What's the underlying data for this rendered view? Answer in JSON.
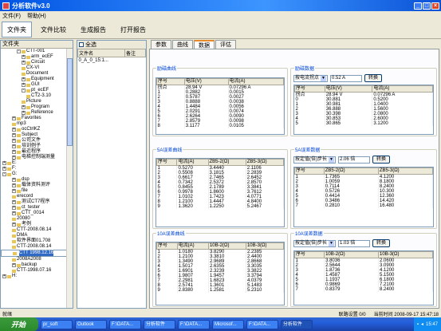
{
  "window": {
    "title": "分析软件v3.0"
  },
  "menu": [
    "文件(F)",
    "帮助(H)"
  ],
  "toolbar": [
    "文件夹",
    "文件比较",
    "生成报告",
    "打开报告"
  ],
  "filepane": {
    "header": "文件夹",
    "tree": [
      {
        "label": "CTT-001",
        "indent": 3,
        "box": "-"
      },
      {
        "label": "arm_ecEF",
        "indent": 4,
        "box": "+"
      },
      {
        "label": "Circuit",
        "indent": 4,
        "box": "+"
      },
      {
        "label": "CX-VI",
        "indent": 4,
        "box": ""
      },
      {
        "label": "Document",
        "indent": 4,
        "box": ""
      },
      {
        "label": "Equipment",
        "indent": 4,
        "box": "+"
      },
      {
        "label": "GUI",
        "indent": 4,
        "box": "+"
      },
      {
        "label": "pt_ecEF",
        "indent": 4,
        "box": "-"
      },
      {
        "label": "CT2-3.10",
        "indent": 5,
        "box": ""
      },
      {
        "label": "Picture",
        "indent": 4,
        "box": ""
      },
      {
        "label": "Program",
        "indent": 4,
        "box": "+"
      },
      {
        "label": "Reference",
        "indent": 4,
        "box": "+"
      },
      {
        "label": "Favorites",
        "indent": 2,
        "box": "+"
      },
      {
        "label": "mp3",
        "indent": 2,
        "box": ""
      },
      {
        "label": "ocCtrlKZ",
        "indent": 2,
        "box": "+"
      },
      {
        "label": "Subject",
        "indent": 2,
        "box": "+"
      },
      {
        "label": "公司文件",
        "indent": 2,
        "box": "+"
      },
      {
        "label": "培训例子",
        "indent": 2,
        "box": "+"
      },
      {
        "label": "最近程序",
        "indent": 2,
        "box": "+"
      },
      {
        "label": "电梯控制端测量",
        "indent": 2,
        "box": "+"
      },
      {
        "label": "E:",
        "indent": 0,
        "box": "+"
      },
      {
        "label": "F:",
        "indent": 0,
        "box": "+"
      },
      {
        "label": "G:",
        "indent": 0,
        "box": "-"
      },
      {
        "label": "dsp",
        "indent": 2,
        "box": "+"
      },
      {
        "label": "载体资料测评",
        "indent": 2,
        "box": "+"
      },
      {
        "label": "file",
        "indent": 2,
        "box": "+"
      },
      {
        "label": "erecord",
        "indent": 2,
        "box": ""
      },
      {
        "label": "测试CT7程序",
        "indent": 2,
        "box": "+"
      },
      {
        "label": "ct_tester",
        "indent": 2,
        "box": "+"
      },
      {
        "label": "CTT_0014",
        "indent": 2,
        "box": "+"
      },
      {
        "label": "20080",
        "indent": 2,
        "box": ""
      },
      {
        "label": "考例",
        "indent": 2,
        "box": "+"
      },
      {
        "label": "CTT-2008.08.14",
        "indent": 2,
        "box": ""
      },
      {
        "label": "DMA",
        "indent": 2,
        "box": ""
      },
      {
        "label": "软件界面01.708",
        "indent": 2,
        "box": ""
      },
      {
        "label": "CTT-2008.08.14",
        "indent": 2,
        "box": ""
      },
      {
        "label": "CTT 1998.12.16",
        "indent": 2,
        "box": "",
        "selected": true
      },
      {
        "label": "2008A2008",
        "indent": 2,
        "box": ""
      },
      {
        "label": "backup",
        "indent": 2,
        "box": "+"
      },
      {
        "label": "CTT-1998.07.16",
        "indent": 2,
        "box": ""
      },
      {
        "label": "H:",
        "indent": 0,
        "box": "+"
      }
    ]
  },
  "listpane": {
    "check_all": "全选",
    "columns": [
      "文件名",
      "备注"
    ],
    "rows": [
      [
        "0_A_0_15:1...",
        ""
      ]
    ]
  },
  "tabs": [
    "参数",
    "曲线",
    "数据",
    "评估"
  ],
  "active_tab": "数据",
  "groups": {
    "excitation": {
      "title": "励磁曲线",
      "columns": [
        "序号",
        "电压(V)",
        "电流(A)"
      ],
      "rows": [
        [
          "拐点",
          "28.94 V",
          "0.07296 A"
        ],
        [
          "1",
          "0.2882",
          "0.0015"
        ],
        [
          "2",
          "0.5787",
          "0.0027"
        ],
        [
          "3",
          "0.8888",
          "0.0038"
        ],
        [
          "4",
          "1.4484",
          "0.0056"
        ],
        [
          "5",
          "2.0291",
          "0.0074"
        ],
        [
          "6",
          "2.6264",
          "0.0090"
        ],
        [
          "7",
          "2.8579",
          "0.0098"
        ],
        [
          "8",
          "3.1177",
          "0.0105"
        ]
      ]
    },
    "excitation_calc": {
      "title": "励磁数据",
      "select": "按电流拐点",
      "value": "0.52 A",
      "button": "转换",
      "columns": [
        "序号",
        "电压(V)",
        "电流(A)"
      ],
      "rows": [
        [
          "拐点",
          "28.94 V",
          "0.07296 A"
        ],
        [
          "0",
          "30.881",
          "0.5200"
        ],
        [
          "1",
          "30.981",
          "1.0400"
        ],
        [
          "2",
          "36.888",
          "1.5600"
        ],
        [
          "3",
          "30.398",
          "2.0800"
        ],
        [
          "4",
          "30.853",
          "2.6000"
        ],
        [
          "5",
          "30.865",
          "3.1200"
        ]
      ]
    },
    "err5": {
      "title": "5A误差曲线",
      "columns": [
        "序号",
        "电流(A)",
        "ZB5-2(Ω)",
        "ZB5-3(Ω)"
      ],
      "rows": [
        [
          "1",
          "0.5270",
          "3.4440",
          "2.1106"
        ],
        [
          "2",
          "0.5508",
          "3.1815",
          "2.2839"
        ],
        [
          "3",
          "0.6617",
          "2.7465",
          "2.6452"
        ],
        [
          "4",
          "0.7342",
          "2.5372",
          "2.8570"
        ],
        [
          "5",
          "0.8455",
          "2.1789",
          "3.3841"
        ],
        [
          "6",
          "0.9978",
          "1.8600",
          "3.7612"
        ],
        [
          "7",
          "1.0102",
          "1.7423",
          "4.0771"
        ],
        [
          "8",
          "1.2100",
          "1.4447",
          "4.8400"
        ],
        [
          "9",
          "1.3620",
          "1.2250",
          "5.2467"
        ]
      ]
    },
    "err5_calc": {
      "title": "5A误差数据",
      "select": "按定值(倍)步长",
      "value": "2.06 倍",
      "button": "转换",
      "columns": [
        "序号",
        "ZB5-2(Ω)",
        "ZB5-3(Ω)"
      ],
      "rows": [
        [
          "1",
          "1.7365",
          "4.1200"
        ],
        [
          "2",
          "1.0059",
          "8.1800"
        ],
        [
          "3",
          "0.7114",
          "8.2400"
        ],
        [
          "4",
          "0.5726",
          "10.300"
        ],
        [
          "5",
          "0.4414",
          "12.360"
        ],
        [
          "6",
          "0.3486",
          "14.420"
        ],
        [
          "7",
          "0.2810",
          "16.480"
        ]
      ]
    },
    "err10": {
      "title": "10A误差曲线",
      "columns": [
        "序号",
        "电流(A)",
        "10B-2(Ω)",
        "10B-3(Ω)"
      ],
      "rows": [
        [
          "1",
          "1.0180",
          "3.8290",
          "2.2385"
        ],
        [
          "2",
          "1.2100",
          "3.3810",
          "2.4400"
        ],
        [
          "3",
          "1.3490",
          "2.9689",
          "2.8668"
        ],
        [
          "4",
          "1.5017",
          "2.6355",
          "3.3035"
        ],
        [
          "5",
          "1.6901",
          "2.3239",
          "3.3822"
        ],
        [
          "6",
          "1.9807",
          "1.9457",
          "3.3794"
        ],
        [
          "7",
          "2.2981",
          "1.6823",
          "4.0379"
        ],
        [
          "8",
          "2.5741",
          "1.3601",
          "5.1483"
        ],
        [
          "9",
          "2.8380",
          "1.2581",
          "5.2310"
        ]
      ]
    },
    "err10_calc": {
      "title": "10A误差数据",
      "select": "按定值(倍)步长",
      "value": "1.03 倍",
      "button": "转换",
      "columns": [
        "序号",
        "10B-2(Ω)",
        "10B-3(Ω)"
      ],
      "rows": [
        [
          "1",
          "3.8036",
          "2.0600"
        ],
        [
          "2",
          "2.5644",
          "3.0900"
        ],
        [
          "3",
          "1.8736",
          "4.1200"
        ],
        [
          "4",
          "1.4587",
          "5.1500"
        ],
        [
          "5",
          "1.1937",
          "6.1800"
        ],
        [
          "6",
          "0.9869",
          "7.2100"
        ],
        [
          "7",
          "0.8379",
          "8.2400"
        ]
      ]
    }
  },
  "status": {
    "left": "就绪",
    "conn": "联路设置 0/0",
    "time": "当前时间 2008-09-17 15:47:18"
  },
  "taskbar": {
    "start": "开始",
    "tasks": [
      "pr_soft",
      "Outlook",
      "F:\\DATA...",
      "分析软件",
      "F:\\DATA...",
      "Microsof...",
      "F:\\DATA...",
      "分析软件"
    ],
    "clock": "15:47"
  }
}
